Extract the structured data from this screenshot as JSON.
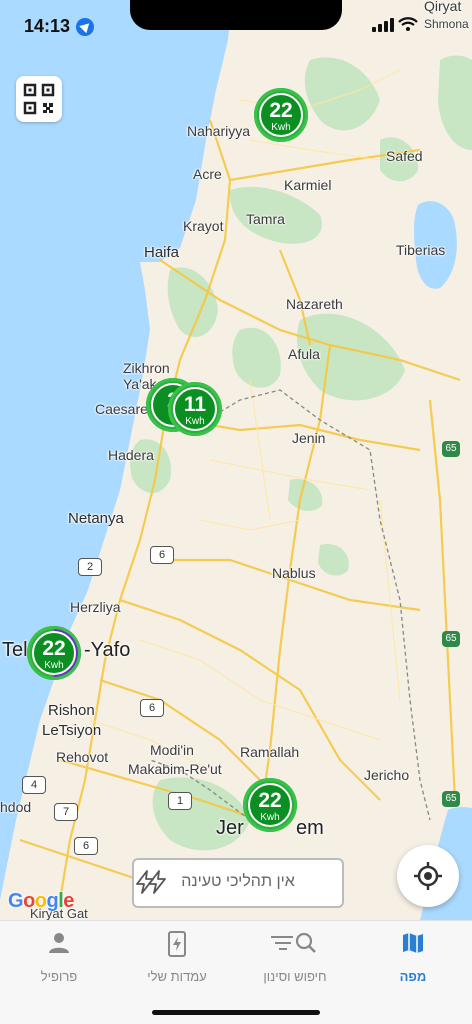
{
  "status_bar": {
    "time": "14:13"
  },
  "map": {
    "cities": [
      {
        "id": "qiryat",
        "name": "Qiryat"
      },
      {
        "id": "shmona",
        "name": "Shmona"
      },
      {
        "id": "nahariyya",
        "name": "Nahariyya"
      },
      {
        "id": "safed",
        "name": "Safed"
      },
      {
        "id": "acre",
        "name": "Acre"
      },
      {
        "id": "karmiel",
        "name": "Karmiel"
      },
      {
        "id": "krayot",
        "name": "Krayot"
      },
      {
        "id": "tamra",
        "name": "Tamra"
      },
      {
        "id": "haifa",
        "name": "Haifa"
      },
      {
        "id": "tiberias",
        "name": "Tiberias"
      },
      {
        "id": "nazareth",
        "name": "Nazareth"
      },
      {
        "id": "afula",
        "name": "Afula"
      },
      {
        "id": "zikhron",
        "name": "Zikhron"
      },
      {
        "id": "yaakov",
        "name": "Ya'akov"
      },
      {
        "id": "caesarea",
        "name": "Caesarea"
      },
      {
        "id": "hadera",
        "name": "Hadera"
      },
      {
        "id": "jenin",
        "name": "Jenin"
      },
      {
        "id": "netanya",
        "name": "Netanya"
      },
      {
        "id": "nablus",
        "name": "Nablus"
      },
      {
        "id": "herzliya",
        "name": "Herzliya"
      },
      {
        "id": "telaviv1",
        "name": "Tel"
      },
      {
        "id": "telaviv2",
        "name": "-Yafo"
      },
      {
        "id": "rishon1",
        "name": "Rishon"
      },
      {
        "id": "rishon2",
        "name": "LeTsiyon"
      },
      {
        "id": "rehovot",
        "name": "Rehovot"
      },
      {
        "id": "modiin",
        "name": "Modi'in"
      },
      {
        "id": "makabim",
        "name": "Makabim-Re'ut"
      },
      {
        "id": "ramallah",
        "name": "Ramallah"
      },
      {
        "id": "jericho",
        "name": "Jericho"
      },
      {
        "id": "ashdod",
        "name": "hdod"
      },
      {
        "id": "jerusalem1",
        "name": "Jer"
      },
      {
        "id": "jerusalem2",
        "name": "em"
      },
      {
        "id": "kiryatgat",
        "name": "Kiryat Gat"
      }
    ],
    "road_shields": [
      {
        "id": "s6a",
        "label": "6"
      },
      {
        "id": "s2",
        "label": "2"
      },
      {
        "id": "s6b",
        "label": "6"
      },
      {
        "id": "s4",
        "label": "4"
      },
      {
        "id": "s7",
        "label": "7"
      },
      {
        "id": "s1",
        "label": "1"
      },
      {
        "id": "s6c",
        "label": "6"
      },
      {
        "id": "s65a",
        "label": "65"
      },
      {
        "id": "s65b",
        "label": "65"
      },
      {
        "id": "s65c",
        "label": "65"
      }
    ],
    "markers": [
      {
        "id": "nahariyya-station",
        "value": "22",
        "unit": "Kwh"
      },
      {
        "id": "caesarea-station-a",
        "value": "2",
        "unit": "K"
      },
      {
        "id": "caesarea-station-b",
        "value": "11",
        "unit": "Kwh"
      },
      {
        "id": "telaviv-station",
        "value": "22",
        "unit": "Kwh"
      },
      {
        "id": "jerusalem-station",
        "value": "22",
        "unit": "Kwh"
      }
    ],
    "google_logo": "Google"
  },
  "charging_status": {
    "text": "אין תהליכי טעינה"
  },
  "tabs": [
    {
      "id": "profile",
      "label": "פרופיל"
    },
    {
      "id": "my-stations",
      "label": "עמדות שלי"
    },
    {
      "id": "search-filter",
      "label": "חיפוש וסינון"
    },
    {
      "id": "map",
      "label": "מפה"
    }
  ],
  "colors": {
    "water": "#aadaff",
    "land": "#f6efe4",
    "park": "#c8e6c3",
    "marker_green": "#0b8f22",
    "active_tab": "#2a7fd4"
  }
}
